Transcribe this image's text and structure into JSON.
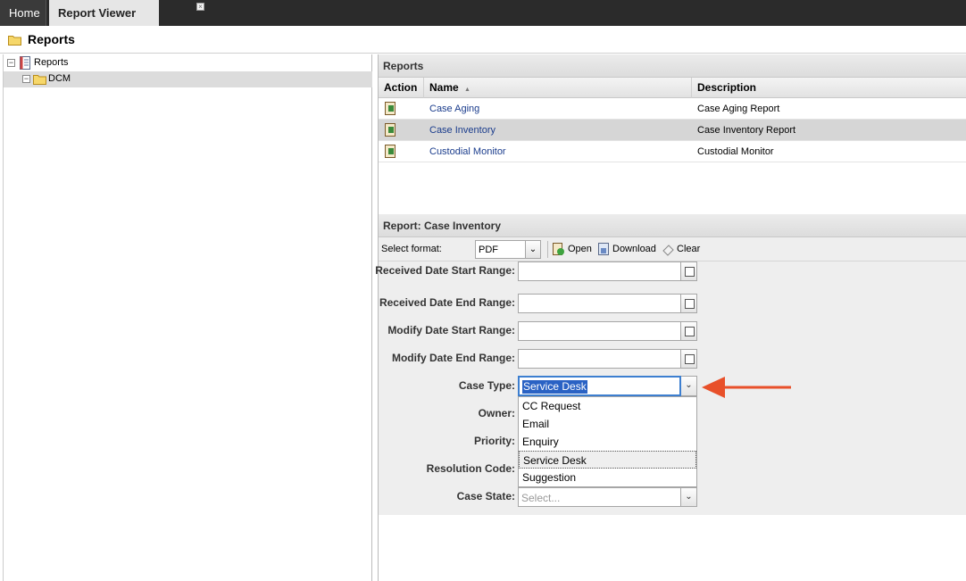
{
  "tabs": {
    "home_label": "Home",
    "report_viewer_label": "Report Viewer",
    "close_glyph": "×"
  },
  "title_bar": {
    "title": "Reports",
    "icon": "folder-icon"
  },
  "tree": {
    "root_label": "Reports",
    "child_label": "DCM",
    "toggle_glyph": "−"
  },
  "reports_panel": {
    "header": "Reports",
    "columns": {
      "action": "Action",
      "name": "Name",
      "description": "Description",
      "sort_glyph": "▲"
    },
    "rows": [
      {
        "name": "Case Aging",
        "description": "Case Aging Report"
      },
      {
        "name": "Case Inventory",
        "description": "Case Inventory Report"
      },
      {
        "name": "Custodial Monitor",
        "description": "Custodial Monitor"
      }
    ]
  },
  "report_form": {
    "header": "Report: Case Inventory",
    "select_format_label": "Select format:",
    "format_value": "PDF",
    "open_label": "Open",
    "download_label": "Download",
    "clear_label": "Clear",
    "fields": {
      "received_start": "Received Date Start Range:",
      "received_end": "Received Date End Range:",
      "modify_start": "Modify Date Start Range:",
      "modify_end": "Modify Date End Range:",
      "case_type": "Case Type:",
      "owner": "Owner:",
      "priority": "Priority:",
      "resolution_code": "Resolution Code:",
      "case_state": "Case State:"
    },
    "case_type_value": "Service Desk",
    "case_type_options": [
      "CC Request",
      "Email",
      "Enquiry",
      "Service Desk",
      "Suggestion"
    ],
    "case_state_placeholder": "Select...",
    "combo_glyph": "⌄"
  },
  "colors": {
    "annotation_arrow": "#e8502a",
    "link": "#1a3c8c",
    "selection": "#2a62c4"
  }
}
